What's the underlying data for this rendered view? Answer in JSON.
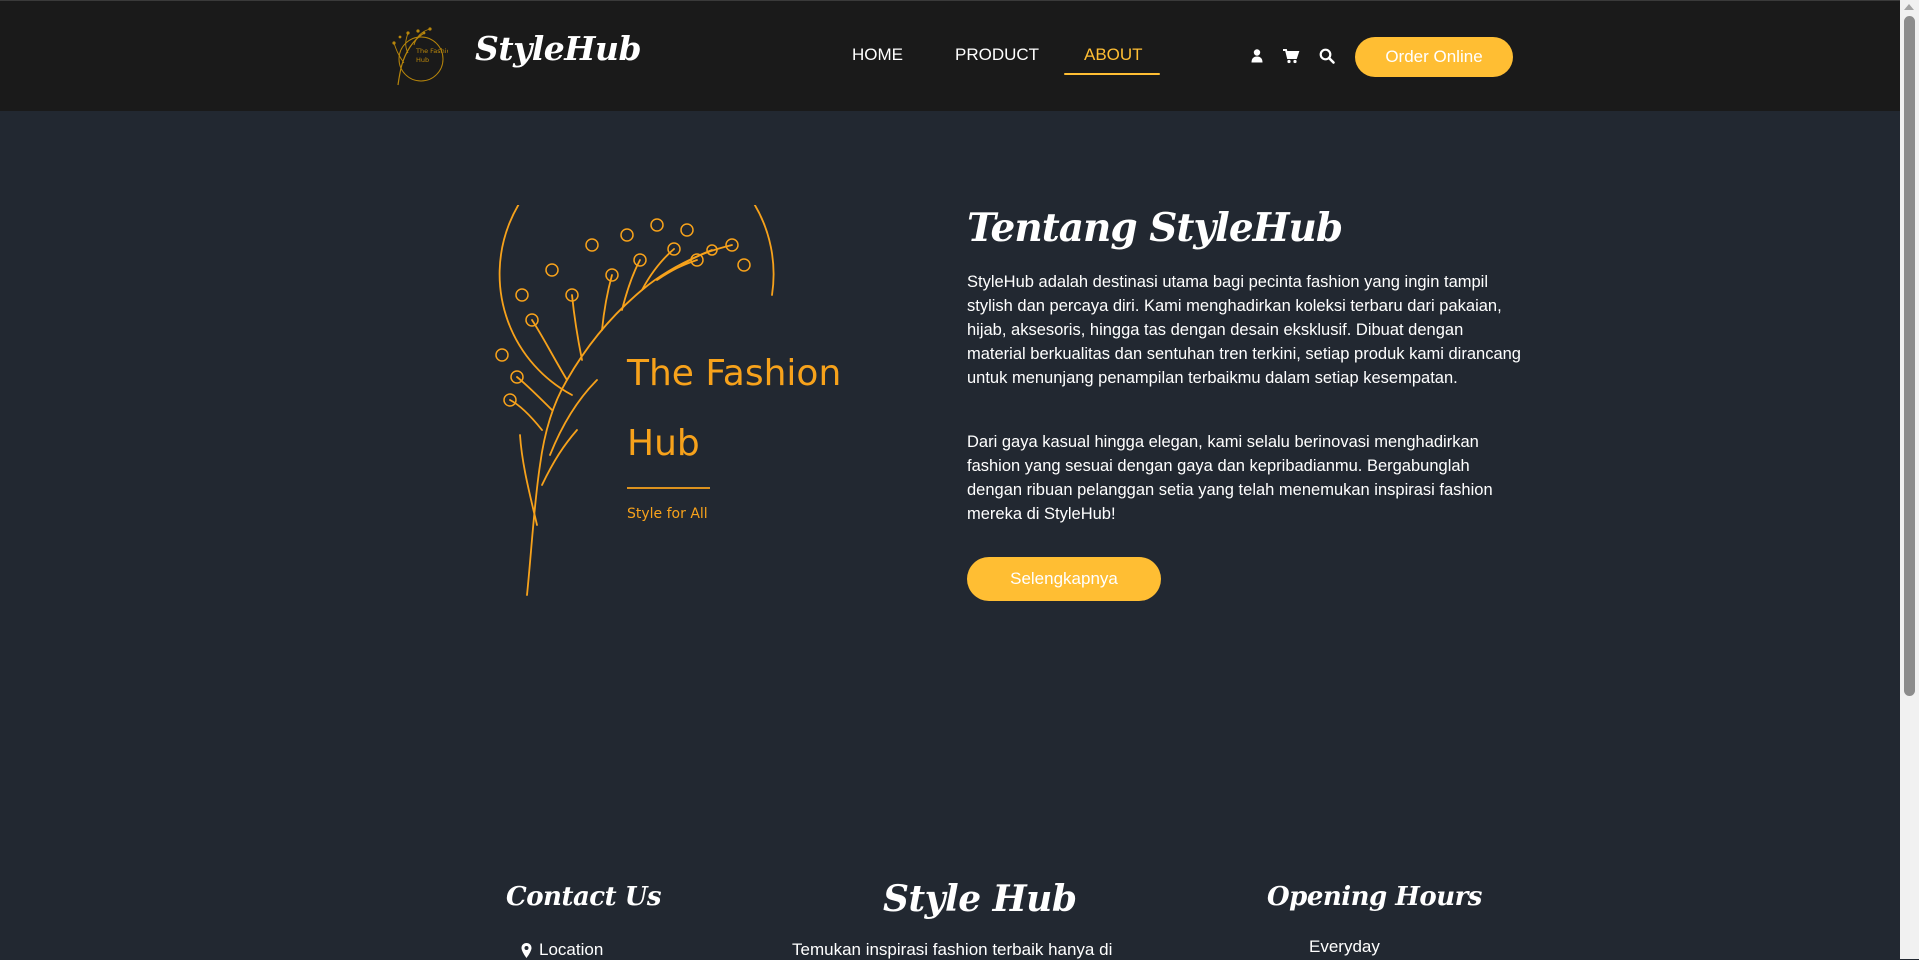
{
  "header": {
    "logo_alt": "The Fashion Hub logo",
    "logo_text": "The Fashion Hub",
    "brand": "StyleHub",
    "nav": [
      {
        "label": "HOME",
        "active": false
      },
      {
        "label": "PRODUCT",
        "active": false
      },
      {
        "label": "ABOUT",
        "active": true
      }
    ],
    "icons": [
      "user-icon",
      "cart-icon",
      "search-icon"
    ],
    "order_button": "Order Online"
  },
  "about": {
    "image_text": {
      "line1": "The Fashion",
      "line2": "Hub",
      "tagline": "Style for All"
    },
    "title": "Tentang StyleHub",
    "paragraph1": "StyleHub adalah destinasi utama bagi pecinta fashion yang ingin tampil stylish dan percaya diri. Kami menghadirkan koleksi terbaru dari pakaian, hijab, aksesoris, hingga tas dengan desain eksklusif. Dibuat dengan material berkualitas dan sentuhan tren terkini, setiap produk kami dirancang untuk menunjang penampilan terbaikmu dalam setiap kesempatan.",
    "paragraph2": "Dari gaya kasual hingga elegan, kami selalu berinovasi menghadirkan fashion yang sesuai dengan gaya dan kepribadianmu. Bergabunglah dengan ribuan pelanggan setia yang telah menemukan inspirasi fashion mereka di StyleHub!",
    "button": "Selengkapnya"
  },
  "footer": {
    "contact_title": "Contact Us",
    "location_label": "Location",
    "center_title": "Style Hub",
    "center_text": "Temukan inspirasi fashion terbaik hanya di",
    "hours_title": "Opening Hours",
    "hours_text": "Everyday"
  },
  "colors": {
    "accent": "#ffbe33",
    "header_bg": "#1a1a1a",
    "page_bg": "#222831"
  }
}
